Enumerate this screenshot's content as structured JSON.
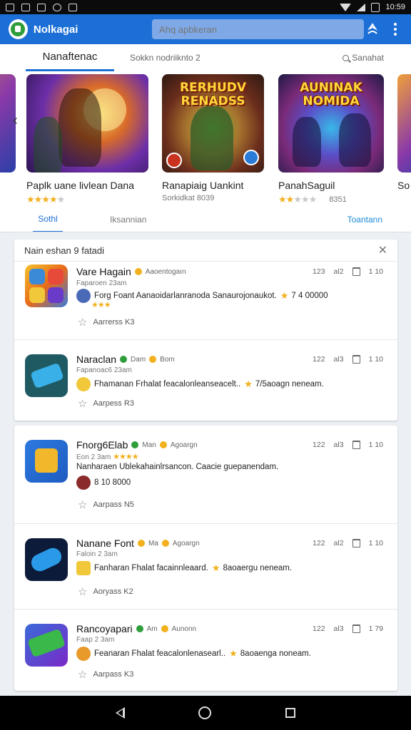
{
  "statusbar": {
    "time": "10:59"
  },
  "appbar": {
    "title": "Nolkagai",
    "search_placeholder": "Ahq apbkeran"
  },
  "top_tabs": {
    "main": "Nanaftenac",
    "secondary": "Sokkn nodriiknto 2",
    "search_label": "Sanahat"
  },
  "carousel": {
    "items": [
      {
        "name": "Paplk uane livlean Dana",
        "rating": 4,
        "meta": "",
        "art_title": ""
      },
      {
        "name": "Ranapiaig Uankint",
        "rating": 0,
        "meta": "Sorkidkat 8039",
        "art_title": "RERHUDV RENADSS"
      },
      {
        "name": "PanahSaguil",
        "rating": 2,
        "meta": "8351",
        "art_title": "AUNINAK NOMIDA"
      },
      {
        "name": "So",
        "rating": 0,
        "meta": "",
        "art_title": ""
      }
    ],
    "subtabs": {
      "active": "Sothl",
      "second": "Iksannian",
      "right": "Toantann"
    }
  },
  "panel1": {
    "header": "Nain eshan 9 fatadi",
    "rows": [
      {
        "title": "Vare Hagain",
        "tag": "Aaoentogaın",
        "sub": "Faparoen 23am",
        "desc": "Forg Foant Aanaoidarlanranoda Sanaurojonaukot.",
        "desc_extra": "7 4 00000",
        "fav": "Aarrerss K3",
        "stat1": "123",
        "stat2": "al2",
        "stat3": "1 10",
        "stars": 3
      },
      {
        "title": "Naraclan",
        "tag": "Dam",
        "tag2": "Bom",
        "sub": "Fapanoac6 23am",
        "desc": "Fhamanan Frhalat feacalonleanseacelt..",
        "desc_extra": "7/5aoagn neneam.",
        "fav": "Aarpess R3",
        "stat1": "122",
        "stat2": "al3",
        "stat3": "1 10",
        "stars": 0
      }
    ]
  },
  "panel2": {
    "rows": [
      {
        "title": "Fnorg6Elab",
        "tag": "Man",
        "tag2": "Agoargn",
        "sub": "Eon 2 3am",
        "desc": "Nanharaen Ublekahainlrsancon. Caacie guepanendam.",
        "desc_extra": "8 10 8000",
        "fav": "Aarpass N5",
        "stat1": "122",
        "stat2": "al3",
        "stat3": "1 10",
        "stars": 4
      },
      {
        "title": "Nanane Font",
        "tag": "Ma",
        "tag2": "Agoargn",
        "sub": "Faloin 2 3am",
        "desc": "Fanharan Fhalat facainnleaard.",
        "desc_extra": "8aoaergu neneam.",
        "fav": "Aoryass K2",
        "stat1": "122",
        "stat2": "al2",
        "stat3": "1 10",
        "stars": 1
      },
      {
        "title": "Rancoyapari",
        "tag": "Am",
        "tag2": "Aunonn",
        "sub": "Faap 2 3am",
        "desc": "Feanaran Fhalat feacalonlenasearl..",
        "desc_extra": "8aoaenga noneam.",
        "fav": "Aarpass K3",
        "stat1": "122",
        "stat2": "al3",
        "stat3": "1 79",
        "stars": 1
      }
    ]
  },
  "colors": {
    "accent": "#1c6fd6",
    "star": "#f2b01e"
  },
  "icons": [
    "search-icon",
    "account-icon",
    "more-vert-icon",
    "close-icon",
    "star-outline-icon",
    "trash-icon",
    "back-icon",
    "home-icon",
    "recents-icon"
  ]
}
